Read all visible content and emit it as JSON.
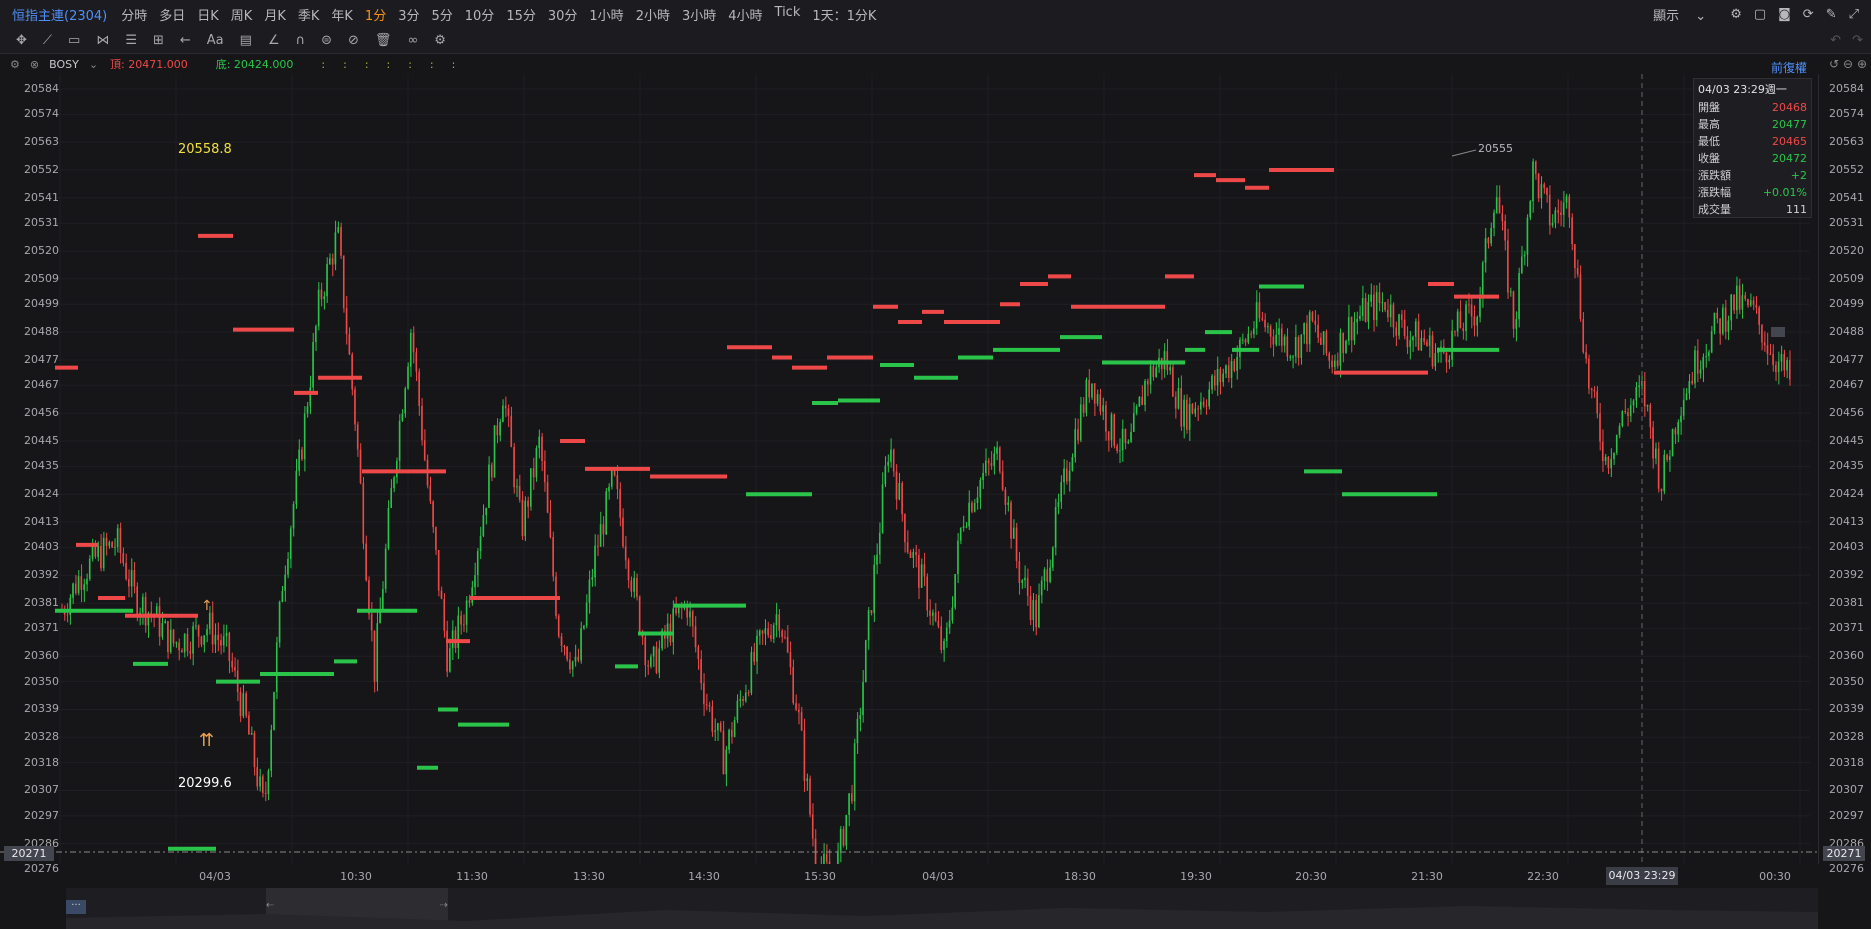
{
  "topbar": {
    "symbol": "恒指主連(2304)",
    "timeframes": [
      "分時",
      "多日",
      "日K",
      "周K",
      "月K",
      "季K",
      "年K",
      "1分",
      "3分",
      "5分",
      "10分",
      "15分",
      "30分",
      "1小時",
      "2小時",
      "3小時",
      "4小時",
      "Tick",
      "1天：1分K"
    ],
    "active_timeframe": "1分",
    "display_label": "顯示"
  },
  "legend": {
    "indicator": "BOSY",
    "top_label": "頂: 20471.000",
    "bottom_label": "底: 20424.000",
    "adjust_label": "前復權"
  },
  "tooltip": {
    "datetime": "04/03 23:29週一",
    "rows": [
      {
        "key": "開盤",
        "value": "20468",
        "color": "#ef4848"
      },
      {
        "key": "最高",
        "value": "20477",
        "color": "#2bc44a"
      },
      {
        "key": "最低",
        "value": "20465",
        "color": "#ef4848"
      },
      {
        "key": "收盤",
        "value": "20472",
        "color": "#2bc44a"
      },
      {
        "key": "漲跌額",
        "value": "+2",
        "color": "#2bc44a"
      },
      {
        "key": "漲跌幅",
        "value": "+0.01%",
        "color": "#2bc44a"
      },
      {
        "key": "成交量",
        "value": "111",
        "color": "#d0d0d4"
      }
    ]
  },
  "annotations": {
    "high": "20558.8",
    "low": "20299.6",
    "peak": "20555"
  },
  "axis": {
    "current_price": "20271",
    "crosshair_time": "04/03 23:29"
  },
  "chart_data": {
    "type": "candlestick",
    "y_ticks": [
      "20584",
      "20574",
      "20563",
      "20552",
      "20541",
      "20531",
      "20520",
      "20509",
      "20499",
      "20488",
      "20477",
      "20467",
      "20456",
      "20445",
      "20435",
      "20424",
      "20413",
      "20403",
      "20392",
      "20381",
      "20371",
      "20360",
      "20350",
      "20339",
      "20328",
      "20318",
      "20307",
      "20297",
      "20286",
      "20276"
    ],
    "x_ticks": [
      "04/03",
      "10:30",
      "11:30",
      "13:30",
      "14:30",
      "15:30",
      "04/03",
      "18:30",
      "19:30",
      "20:30",
      "21:30",
      "22:30",
      "04/03 23:29",
      "00:30"
    ],
    "close_path": [
      20378,
      20392,
      20400,
      20405,
      20383,
      20376,
      20365,
      20368,
      20372,
      20362,
      20335,
      20299,
      20390,
      20440,
      20500,
      20527,
      20450,
      20354,
      20430,
      20490,
      20420,
      20358,
      20380,
      20420,
      20465,
      20410,
      20445,
      20372,
      20354,
      20400,
      20430,
      20390,
      20354,
      20370,
      20381,
      20344,
      20320,
      20345,
      20365,
      20378,
      20340,
      20280,
      20271,
      20310,
      20380,
      20445,
      20405,
      20385,
      20360,
      20415,
      20430,
      20440,
      20395,
      20375,
      20410,
      20445,
      20470,
      20450,
      20440,
      20470,
      20478,
      20455,
      20462,
      20470,
      20480,
      20493,
      20488,
      20482,
      20491,
      20476,
      20490,
      20497,
      20500,
      20488,
      20485,
      20478,
      20490,
      20497,
      20546,
      20490,
      20552,
      20532,
      20540,
      20470,
      20437,
      20456,
      20465,
      20428,
      20460,
      20478,
      20490,
      20500,
      20496,
      20480,
      20469
    ],
    "bos_top": [
      [
        55,
        78,
        20474
      ],
      [
        76,
        98,
        20404
      ],
      [
        98,
        125,
        20383
      ],
      [
        125,
        198,
        20376
      ],
      [
        198,
        233,
        20526
      ],
      [
        233,
        294,
        20489
      ],
      [
        294,
        318,
        20464
      ],
      [
        318,
        362,
        20470
      ],
      [
        362,
        446,
        20433
      ],
      [
        446,
        470,
        20366
      ],
      [
        470,
        560,
        20383
      ],
      [
        560,
        585,
        20445
      ],
      [
        585,
        650,
        20434
      ],
      [
        650,
        727,
        20431
      ],
      [
        727,
        772,
        20482
      ],
      [
        772,
        792,
        20478
      ],
      [
        792,
        827,
        20474
      ],
      [
        827,
        873,
        20478
      ],
      [
        873,
        898,
        20498
      ],
      [
        898,
        922,
        20492
      ],
      [
        922,
        944,
        20496
      ],
      [
        944,
        1000,
        20492
      ],
      [
        1000,
        1020,
        20499
      ],
      [
        1020,
        1048,
        20507
      ],
      [
        1048,
        1071,
        20510
      ],
      [
        1071,
        1165,
        20498
      ],
      [
        1165,
        1194,
        20510
      ],
      [
        1194,
        1216,
        20550
      ],
      [
        1216,
        1245,
        20548
      ],
      [
        1245,
        1269,
        20545
      ],
      [
        1269,
        1334,
        20552
      ],
      [
        1334,
        1428,
        20472
      ],
      [
        1428,
        1454,
        20507
      ],
      [
        1454,
        1499,
        20502
      ]
    ],
    "bos_bottom": [
      [
        55,
        133,
        20378
      ],
      [
        133,
        168,
        20357
      ],
      [
        168,
        216,
        20284
      ],
      [
        216,
        260,
        20350
      ],
      [
        260,
        334,
        20353
      ],
      [
        334,
        357,
        20358
      ],
      [
        357,
        417,
        20378
      ],
      [
        417,
        438,
        20316
      ],
      [
        438,
        458,
        20339
      ],
      [
        458,
        509,
        20333
      ],
      [
        615,
        638,
        20356
      ],
      [
        638,
        674,
        20369
      ],
      [
        674,
        746,
        20380
      ],
      [
        746,
        812,
        20424
      ],
      [
        812,
        838,
        20460
      ],
      [
        838,
        880,
        20461
      ],
      [
        880,
        914,
        20475
      ],
      [
        914,
        958,
        20470
      ],
      [
        958,
        993,
        20478
      ],
      [
        993,
        1060,
        20481
      ],
      [
        1060,
        1102,
        20486
      ],
      [
        1102,
        1185,
        20476
      ],
      [
        1185,
        1205,
        20481
      ],
      [
        1205,
        1232,
        20488
      ],
      [
        1232,
        1259,
        20481
      ],
      [
        1259,
        1304,
        20506
      ],
      [
        1304,
        1342,
        20433
      ],
      [
        1342,
        1437,
        20424
      ],
      [
        1437,
        1499,
        20481
      ]
    ]
  }
}
